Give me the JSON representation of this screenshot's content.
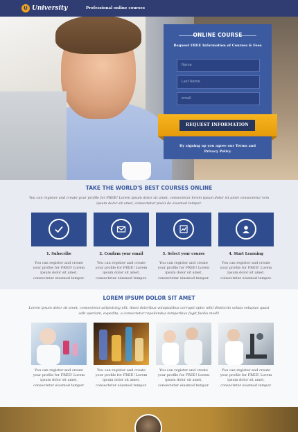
{
  "header": {
    "logo_badge": "U",
    "logo_text": "University",
    "tagline": "Professional online courses"
  },
  "form": {
    "title": "ONLINE COURSE",
    "subtitle": "Request FREE Information of Courses & Fees",
    "fields": [
      {
        "placeholder": "Name"
      },
      {
        "placeholder": "Last Name"
      },
      {
        "placeholder": "email"
      }
    ],
    "button": "REQUEST INFORMATION",
    "note": "By signing up you agree our Terms and Privacy Policy"
  },
  "section1": {
    "heading": "TAKE THE WORLD'S BEST COURSES ONLINE",
    "intro": "You can register and create your profile for FREE! Lorem ipsum dolor sit amet, consectetur lorem ipsum dolor sit amet consectetur rem ipsum dolor sit amet, consectetur pisici do eiusmod tempor.",
    "steps": [
      {
        "icon": "check-icon",
        "title": "1. Subscribe",
        "text": "You can register and create your profile for FREE! Lorem ipsum dolor sit amet, consectetur eiusmod tempor."
      },
      {
        "icon": "mail-icon",
        "title": "2. Confirm your email",
        "text": "You can register and create your profile for FREE! Lorem ipsum dolor sit amet, consectetur eiusmod tempor."
      },
      {
        "icon": "chart-icon",
        "title": "3. Select your course",
        "text": "You can register and create your profile for FREE! Lorem ipsum dolor sit amet, consectetur eiusmod tempor."
      },
      {
        "icon": "user-icon",
        "title": "4. Start Learning",
        "text": "You can register and create your profile for FREE! Lorem ipsum dolor sit amet, consectetur eiusmod tempor."
      }
    ]
  },
  "section2": {
    "heading": "LOREM IPSUM DOLOR SIT AMET",
    "intro": "Lorem ipsum dolor sit amet, consectetur adipisicing elit. Amet doloribus voluptatibus corrupti optio nihil distinctio soluta voluptas quasi odit aperiam, expedita, a consectetur repellendus temporibus fugit facilis modi!",
    "cards": [
      {
        "text": "You can register and create your profile for FREE! Lorem ipsum dolor sit amet, consectetur eiusmod tempor."
      },
      {
        "text": "You can register and create your profile for FREE! Lorem ipsum dolor sit amet, consectetur eiusmod tempor."
      },
      {
        "text": "You can register and create your profile for FREE! Lorem ipsum dolor sit amet, consectetur eiusmod tempor."
      },
      {
        "text": "You can register and create your profile for FREE! Lorem ipsum dolor sit amet, consectetur eiusmod tempor."
      }
    ]
  },
  "colors": {
    "navy": "#2f3d73",
    "form_blue": "#3b5aa0",
    "accent_orange": "#f0a31a",
    "step_blue": "#2f4c8e"
  }
}
